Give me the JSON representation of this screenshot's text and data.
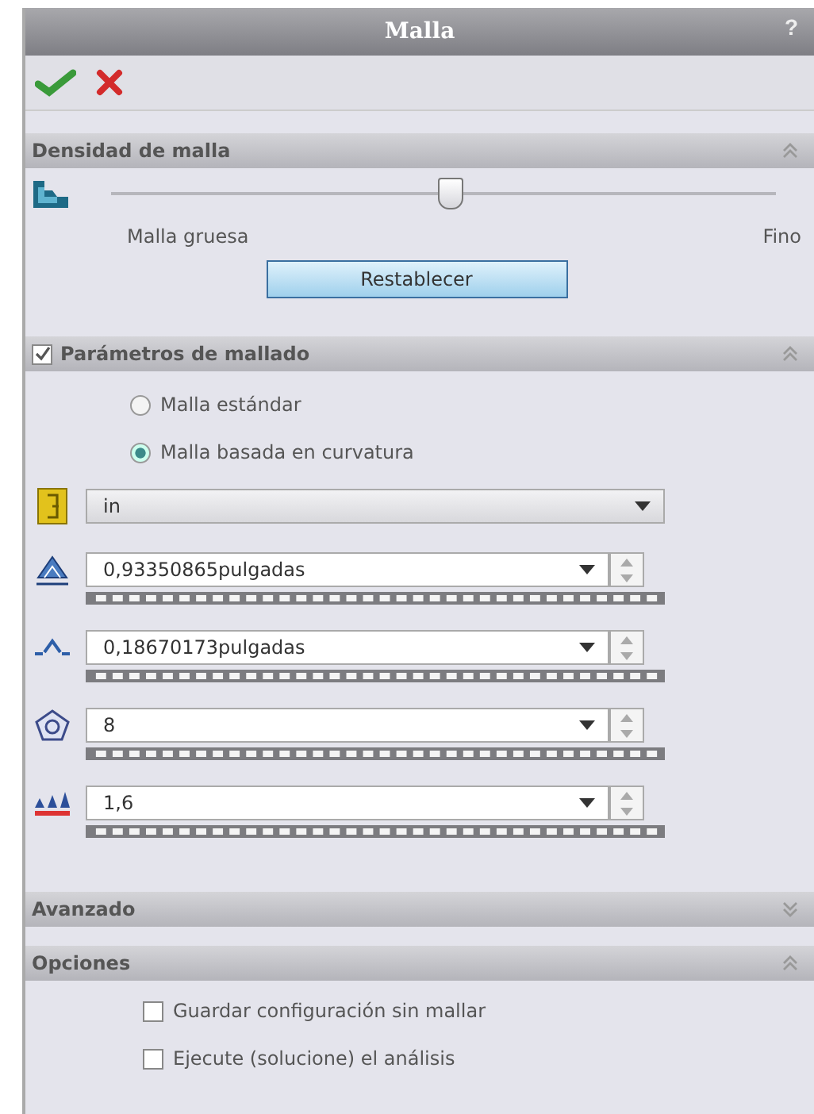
{
  "window": {
    "title": "Malla",
    "help": "?"
  },
  "toolbar": [
    {
      "kind": "ok"
    },
    {
      "kind": "cancel"
    }
  ],
  "sections": [
    {
      "kind": "density",
      "title": "Densidad de malla",
      "expanded": true,
      "slider": {
        "level": 0.51,
        "min_label": "Malla gruesa",
        "max_label": "Fino"
      },
      "button": "Restablecer"
    },
    {
      "kind": "parameters",
      "title": "Parámetros de mallado",
      "checked": true,
      "expanded": true,
      "radios": [
        {
          "label": "Malla estándar",
          "selected": false
        },
        {
          "label": "Malla basada en curvatura",
          "selected": true
        }
      ],
      "unit": {
        "value": "in"
      },
      "fields": [
        {
          "kind": "max-size",
          "value": "0,93350865pulgadas"
        },
        {
          "kind": "min-size",
          "value": "0,18670173pulgadas"
        },
        {
          "kind": "circle-count",
          "value": "8"
        },
        {
          "kind": "growth-ratio",
          "value": "1,6"
        }
      ]
    },
    {
      "kind": "plain",
      "title": "Avanzado",
      "expanded": false
    },
    {
      "kind": "options",
      "title": "Opciones",
      "expanded": true,
      "checkboxes": [
        {
          "label": "Guardar configuración sin mallar",
          "checked": false
        },
        {
          "label": "Ejecute (solucione) el análisis",
          "checked": false
        }
      ]
    }
  ]
}
